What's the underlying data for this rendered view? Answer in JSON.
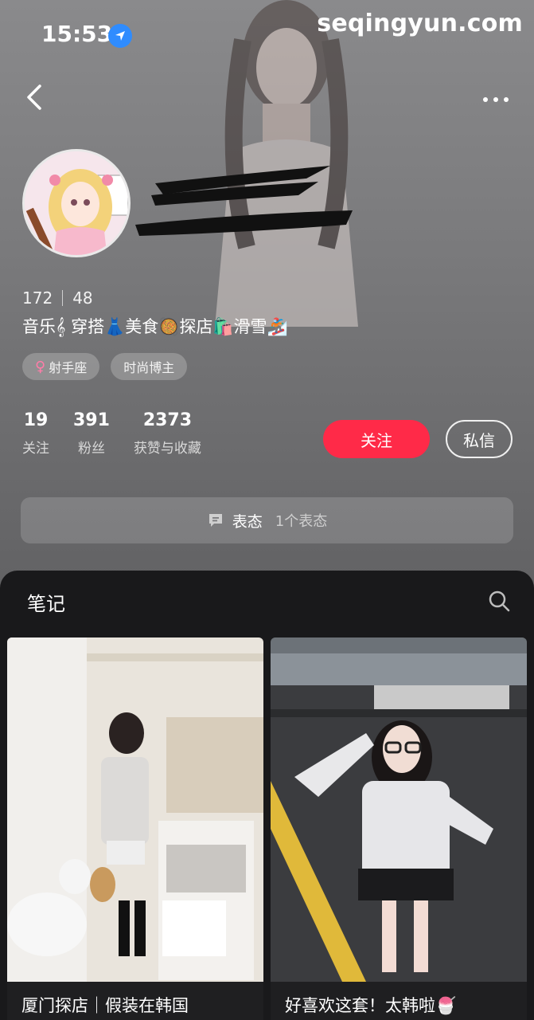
{
  "status_bar": {
    "time": "15:53"
  },
  "watermark": "seqingyun.com",
  "profile": {
    "ids": [
      "172",
      "48"
    ],
    "bio": "音乐𝄞 穿搭👗美食🥘探店🛍️滑雪🏂",
    "tags": [
      {
        "label": "射手座",
        "gender_symbol": "♀"
      },
      {
        "label": "时尚博主"
      }
    ],
    "stats": [
      {
        "value": "19",
        "label": "关注"
      },
      {
        "value": "391",
        "label": "粉丝"
      },
      {
        "value": "2373",
        "label": "获赞与收藏"
      }
    ],
    "follow_label": "关注",
    "message_label": "私信",
    "mood": {
      "title": "表态",
      "count": "1个表态"
    }
  },
  "notes": {
    "tab_title": "笔记",
    "cards": [
      {
        "caption": "厦门探店｜假装在韩国"
      },
      {
        "caption": "好喜欢这套！太韩啦🍧"
      }
    ]
  },
  "colors": {
    "accent": "#ff2a48",
    "location": "#2f8cff"
  }
}
